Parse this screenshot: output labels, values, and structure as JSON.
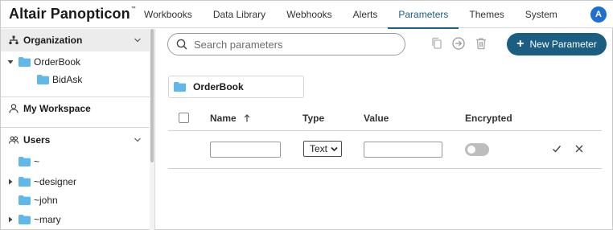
{
  "app": {
    "title": "Altair Panopticon",
    "trademark": "™"
  },
  "nav": {
    "tabs": [
      "Workbooks",
      "Data Library",
      "Webhooks",
      "Alerts",
      "Parameters",
      "Themes",
      "System"
    ],
    "active": "Parameters"
  },
  "user": {
    "avatar_initial": "A",
    "avatar_color": "#1f6fd1"
  },
  "sidebar": {
    "organization_label": "Organization",
    "organization_tree": [
      {
        "label": "OrderBook",
        "level": 0,
        "expanded": true
      },
      {
        "label": "BidAsk",
        "level": 1
      }
    ],
    "workspace_label": "My Workspace",
    "users_label": "Users",
    "users": [
      {
        "label": "~",
        "has_children": false
      },
      {
        "label": "~designer",
        "has_children": true
      },
      {
        "label": "~john",
        "has_children": false
      },
      {
        "label": "~mary",
        "has_children": true
      }
    ]
  },
  "toolbar": {
    "search_placeholder": "Search parameters",
    "new_button_label": "New Parameter",
    "icons": [
      "copy-icon",
      "move-icon",
      "delete-icon"
    ]
  },
  "breadcrumb": {
    "label": "OrderBook"
  },
  "table": {
    "columns": [
      "Name",
      "Type",
      "Value",
      "Encrypted"
    ],
    "sort_column": "Name",
    "sort_direction": "ascending",
    "new_row": {
      "name": "",
      "type": "Text",
      "value": "",
      "encrypted": false
    }
  },
  "colors": {
    "accent": "#1b5e82",
    "folder": "#5fb8e8",
    "avatar": "#1f6fd1"
  }
}
